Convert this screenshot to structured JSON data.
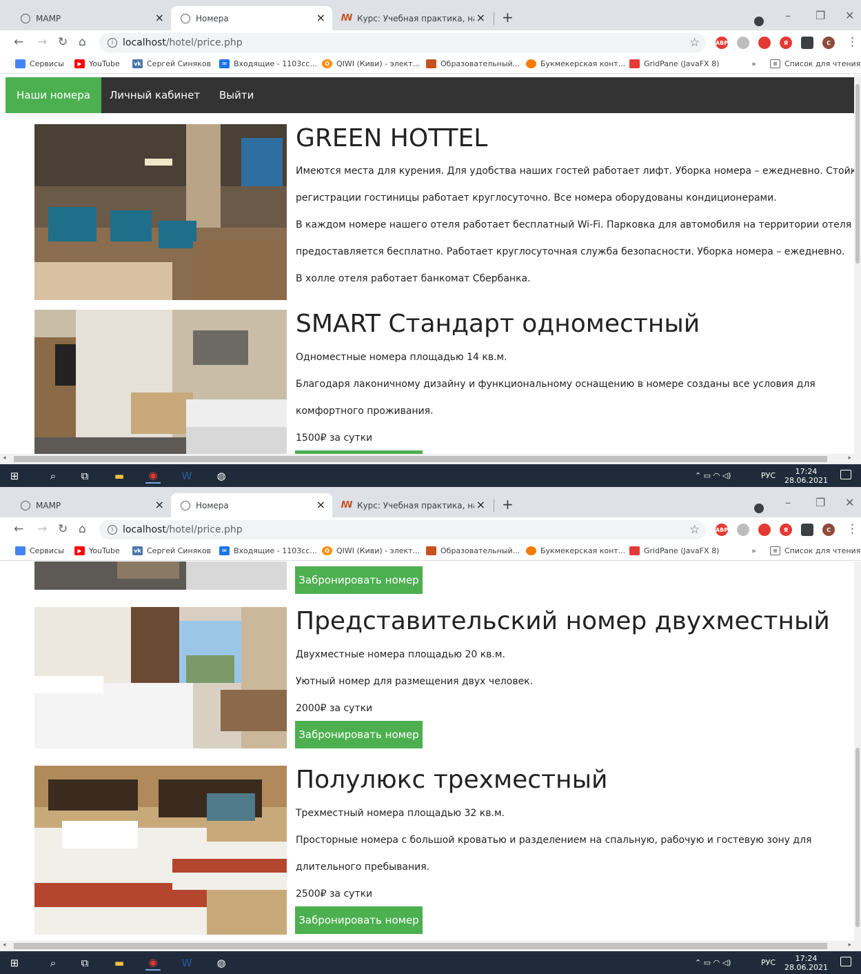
{
  "browser": {
    "tabs": [
      {
        "title": "MAMP",
        "active": false
      },
      {
        "title": "Номера",
        "active": true
      },
      {
        "title": "Курс: Учебная практика, научно",
        "active": false
      }
    ],
    "url_host": "localhost",
    "url_path": "/hotel/price.php",
    "bookmarks": [
      {
        "label": "Сервисы",
        "icon": "apps-grid-icon",
        "color": "#4285f4"
      },
      {
        "label": "YouTube",
        "icon": "youtube-icon",
        "color": "#ff0000"
      },
      {
        "label": "Сергей Синяков",
        "icon": "vk-icon",
        "color": "#4a76a8"
      },
      {
        "label": "Входящие - 1103сс...",
        "icon": "mail-icon",
        "color": "#1a73e8"
      },
      {
        "label": "QIWI (Киви) - элект...",
        "icon": "qiwi-icon",
        "color": "#ff8c00"
      },
      {
        "label": "Образовательный...",
        "icon": "stepik-icon",
        "color": "#c7511f"
      },
      {
        "label": "Букмекерская конт...",
        "icon": "bookmaker-icon",
        "color": "#f57c00"
      },
      {
        "label": "GridPane (JavaFX 8)",
        "icon": "oracle-icon",
        "color": "#e53935"
      }
    ],
    "more_bookmarks": "»",
    "reading_list": "Список для чтения"
  },
  "nav": {
    "items": [
      {
        "label": "Наши номера",
        "active": true
      },
      {
        "label": "Личный кабинет",
        "active": false
      },
      {
        "label": "Выйти",
        "active": false
      }
    ]
  },
  "hotel": {
    "title": "GREEN HOTTEL",
    "lines": [
      "Имеются места для курения. Для удобства наших гостей работает лифт. Уборка номера – ежедневно. Стойка",
      "регистрации гостиницы работает круглосуточно. Все номера оборудованы кондиционерами.",
      "В каждом номере нашего отеля работает бесплатный Wi-Fi. Парковка для автомобиля на территории отеля",
      "предоставляется бесплатно. Работает круглосуточная служба безопасности. Уборка номера – ежедневно.",
      "В холле отеля работает банкомат Сбербанка."
    ]
  },
  "rooms": [
    {
      "title": "SMART Стандарт одноместный",
      "area": "Одноместные номера площадью 14 кв.м.",
      "desc": [
        "Благодаря лаконичному дизайну и функциональному оснащению в номере созданы все условия для",
        "комфортного проживания."
      ],
      "price": "1500₽ за сутки",
      "button": "Забронировать номер"
    },
    {
      "title": "Представительский номер двухместный",
      "area": "Двухместные номера площадью 20 кв.м.",
      "desc": [
        "Уютный номер для размещения двух человек."
      ],
      "price": "2000₽ за сутки",
      "button": "Забронировать номер"
    },
    {
      "title": "Полулюкс трехместный",
      "area": "Трехместный номера площадью 32 кв.м.",
      "desc": [
        "Просторные номера с большой кроватью и разделением на спальную, рабочую и гостевую зону для",
        "длительного пребывания."
      ],
      "price": "2500₽ за сутки",
      "button": "Забронировать номер"
    }
  ],
  "taskbar": {
    "lang": "РУС",
    "time": "17:24",
    "date": "28.06.2021"
  },
  "colors": {
    "accent_green": "#4caf50",
    "navbar_dark": "#333333",
    "taskbar": "#1f2b3a"
  }
}
